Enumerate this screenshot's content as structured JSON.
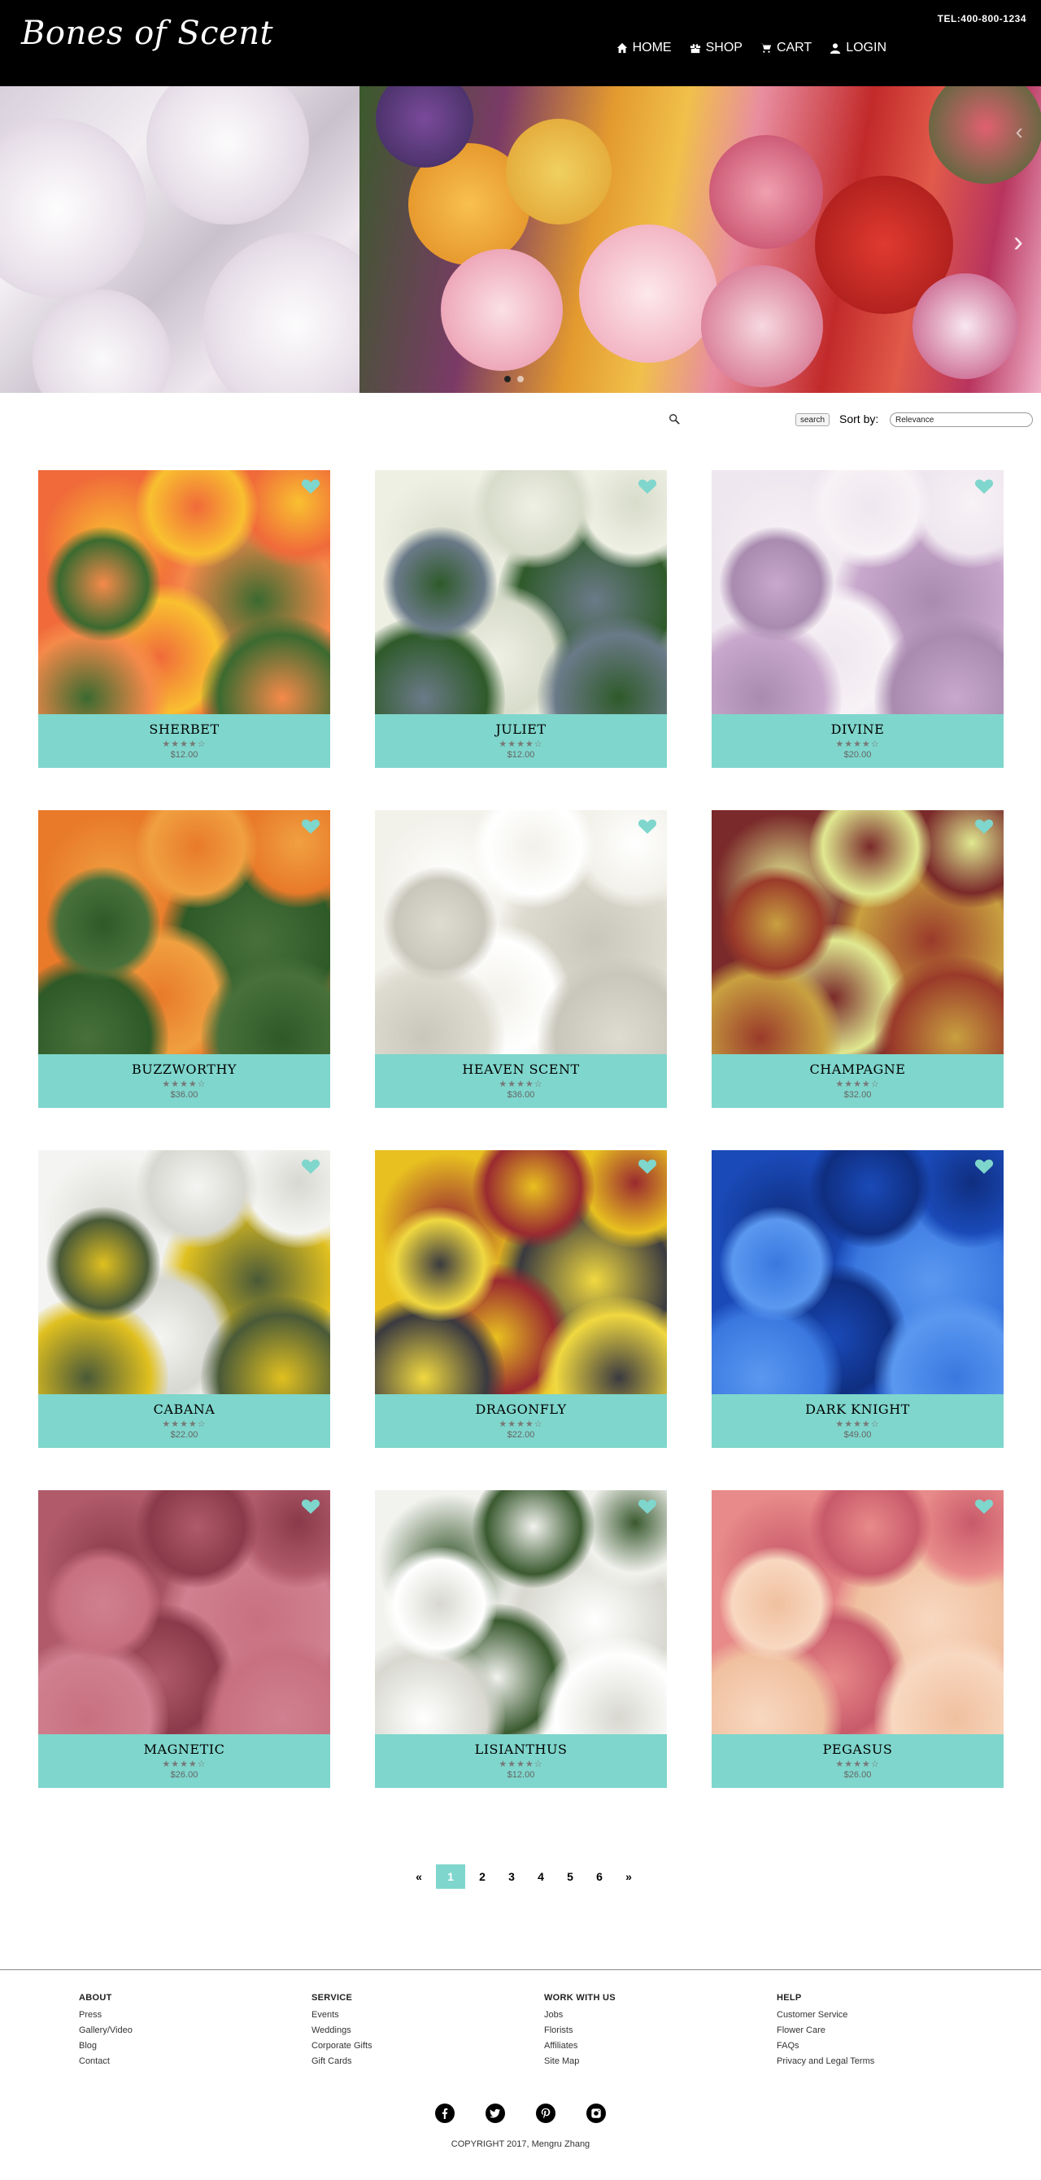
{
  "header": {
    "logo": "Bones of Scent",
    "tel": "TEL:400-800-1234",
    "nav": [
      {
        "label": "HOME",
        "icon": "home-icon"
      },
      {
        "label": "SHOP",
        "icon": "gift-icon"
      },
      {
        "label": "CART",
        "icon": "cart-icon"
      },
      {
        "label": "LOGIN",
        "icon": "user-icon"
      }
    ]
  },
  "hero": {
    "next_arrow": "›",
    "dots_count": 2,
    "active_dot": 0
  },
  "toolbar": {
    "search_button": "search",
    "sort_label": "Sort by:",
    "sort_value": "Relevance"
  },
  "colors": {
    "accent": "#7fd6cc",
    "header_bg": "#000000"
  },
  "products": [
    {
      "name": "SHERBET",
      "stars": "★★★★☆",
      "price": "$12.00",
      "colors": [
        "#f06a3a",
        "#f58a4a",
        "#f9c030",
        "#3b6a30"
      ]
    },
    {
      "name": "JULIET",
      "stars": "★★★★☆",
      "price": "$12.00",
      "colors": [
        "#eef0e4",
        "#2f5a2a",
        "#d8dccb",
        "#6a7a88"
      ]
    },
    {
      "name": "DIVINE",
      "stars": "★★★★☆",
      "price": "$20.00",
      "colors": [
        "#efe7ef",
        "#c8a8cc",
        "#f7f2f6",
        "#a98bb0"
      ]
    },
    {
      "name": "BUZZWORTHY",
      "stars": "★★★★☆",
      "price": "$36.00",
      "colors": [
        "#e87a2a",
        "#2e5a28",
        "#f0a040",
        "#48703a"
      ]
    },
    {
      "name": "HEAVEN SCENT",
      "stars": "★★★★☆",
      "price": "$36.00",
      "colors": [
        "#f2f1ea",
        "#dedcd0",
        "#ffffff",
        "#c9c7bb"
      ]
    },
    {
      "name": "CHAMPAGNE",
      "stars": "★★★★☆",
      "price": "$32.00",
      "colors": [
        "#7a2a2a",
        "#c8a040",
        "#e0e890",
        "#9a3a2a"
      ]
    },
    {
      "name": "CABANA",
      "stars": "★★★★☆",
      "price": "$22.00",
      "colors": [
        "#f4f4f2",
        "#e0c020",
        "#d8d8d2",
        "#4a5a38"
      ]
    },
    {
      "name": "DRAGONFLY",
      "stars": "★★★★☆",
      "price": "$22.00",
      "colors": [
        "#e8c020",
        "#3a3a40",
        "#9a2a30",
        "#f0d840"
      ]
    },
    {
      "name": "DARK KNIGHT",
      "stars": "★★★★☆",
      "price": "$49.00",
      "colors": [
        "#1a4ab8",
        "#3a78e0",
        "#0f2e80",
        "#5a98f0"
      ]
    },
    {
      "name": "MAGNETIC",
      "stars": "★★★★☆",
      "price": "$26.00",
      "colors": [
        "#b05a6a",
        "#d08090",
        "#8a3a4a",
        "#c87080"
      ]
    },
    {
      "name": "LISIANTHUS",
      "stars": "★★★★☆",
      "price": "$12.00",
      "colors": [
        "#f2f2ee",
        "#d8d8d0",
        "#3a5a30",
        "#ffffff"
      ]
    },
    {
      "name": "PEGASUS",
      "stars": "★★★★☆",
      "price": "$26.00",
      "colors": [
        "#e88a8a",
        "#f0c0a0",
        "#c85a6a",
        "#f8d8c0"
      ]
    }
  ],
  "pagination": {
    "prev": "«",
    "pages": [
      "1",
      "2",
      "3",
      "4",
      "5",
      "6"
    ],
    "active": "1",
    "next": "»"
  },
  "footer": {
    "columns": [
      {
        "heading": "ABOUT",
        "links": [
          "Press",
          "Gallery/Video",
          "Blog",
          "Contact"
        ]
      },
      {
        "heading": "SERVICE",
        "links": [
          "Events",
          "Weddings",
          "Corporate Gifts",
          "Gift Cards"
        ]
      },
      {
        "heading": "WORK WITH US",
        "links": [
          "Jobs",
          "Florists",
          "Affiliates",
          "Site Map"
        ]
      },
      {
        "heading": "HELP",
        "links": [
          "Customer Service",
          "Flower Care",
          "FAQs",
          "Privacy and Legal Terms"
        ]
      }
    ],
    "social": [
      "facebook-icon",
      "twitter-icon",
      "pinterest-icon",
      "instagram-icon"
    ],
    "copyright": "COPYRIGHT 2017, Mengru Zhang"
  }
}
